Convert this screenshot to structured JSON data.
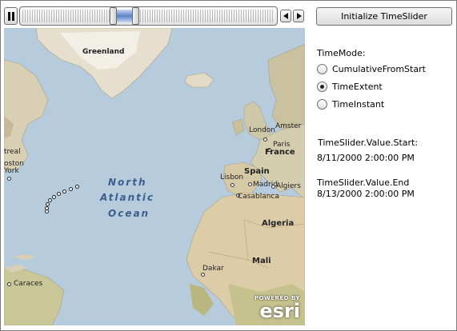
{
  "time_slider": {
    "play_button": "pause-icon",
    "extent_start_fraction": 0.37,
    "extent_end_fraction": 0.44
  },
  "map": {
    "labels": {
      "greenland": "Greenland",
      "north": "North",
      "atlantic": "Atlantic",
      "ocean": "Ocean",
      "london": "London",
      "amsterdam": "Amster",
      "paris": "Paris",
      "france": "France",
      "spain": "Spain",
      "lisbon": "Lisbon",
      "madrid": "Madrid",
      "algiers": "Algiers",
      "casablanca": "Casablanca",
      "algeria": "Algeria",
      "mali": "Mali",
      "dakar": "Dakar",
      "caracas": "Caraces",
      "montreal": "treal",
      "boston": "oston",
      "newyork": "York"
    },
    "attribution": {
      "powered": "POWERED BY",
      "logo": "esri"
    }
  },
  "panel": {
    "init_button": "Initialize TimeSlider",
    "timemode_label": "TimeMode:",
    "modes": [
      {
        "label": "CumulativeFromStart",
        "checked": false
      },
      {
        "label": "TimeExtent",
        "checked": true
      },
      {
        "label": "TimeInstant",
        "checked": false
      }
    ],
    "start_label": "TimeSlider.Value.Start:",
    "start_value": "8/11/2000 2:00:00 PM",
    "end_label": "TimeSlider.Value.End",
    "end_value": "8/13/2000 2:00:00 PM"
  }
}
